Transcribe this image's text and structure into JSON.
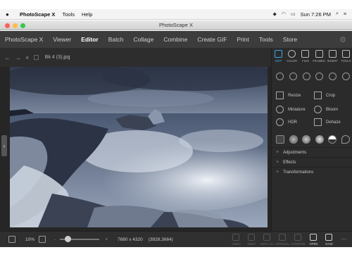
{
  "menu_bar": {
    "apple": "",
    "app_name": "PhotoScape X",
    "items": [
      "Tools",
      "Help"
    ],
    "clock": "Sun 7:26 PM"
  },
  "window": {
    "title": "PhotoScape X"
  },
  "nav": {
    "tabs": [
      "PhotoScape X",
      "Viewer",
      "Editor",
      "Batch",
      "Collage",
      "Combine",
      "Create GIF",
      "Print",
      "Tools",
      "Store"
    ],
    "active": "Editor"
  },
  "file": {
    "name": "Bk 4 (3).jpg"
  },
  "panel": {
    "top_tools": [
      {
        "label": "EDIT",
        "icon": "edit-icon",
        "active": true
      },
      {
        "label": "COLOR",
        "icon": "color-icon",
        "active": false
      },
      {
        "label": "FILM",
        "icon": "film-icon",
        "active": false
      },
      {
        "label": "FRAMES",
        "icon": "frames-icon",
        "active": false
      },
      {
        "label": "INSERT",
        "icon": "insert-icon",
        "active": false
      },
      {
        "label": "TOOLS",
        "icon": "tools-icon",
        "active": false
      }
    ],
    "features": [
      {
        "label": "Resize",
        "icon": "resize-icon"
      },
      {
        "label": "Crop",
        "icon": "crop-icon"
      },
      {
        "label": "Miniature",
        "icon": "miniature-icon"
      },
      {
        "label": "Bloom",
        "icon": "bloom-icon"
      },
      {
        "label": "HDR",
        "icon": "hdr-icon"
      },
      {
        "label": "Dehaze",
        "icon": "dehaze-icon"
      }
    ],
    "sections": [
      "Adjustments",
      "Effects",
      "Transformations"
    ]
  },
  "bottom": {
    "zoom": "10%",
    "zoom_minus": "-",
    "zoom_plus": "+",
    "dimensions": "7680 x 4320",
    "coords": "(3928,3664)",
    "actions": [
      {
        "label": "UNDO",
        "on": false
      },
      {
        "label": "REDO",
        "on": false
      },
      {
        "label": "UNDO ALL",
        "on": false
      },
      {
        "label": "ORIGINAL",
        "on": false
      },
      {
        "label": "COMPARE",
        "on": false
      },
      {
        "label": "OPEN",
        "on": true
      },
      {
        "label": "SAVE",
        "on": true
      }
    ],
    "more": "..."
  },
  "colors": {
    "accent": "#3aa9e6",
    "nav_bg": "#3c3c3c",
    "app_bg": "#2d2d2d"
  }
}
